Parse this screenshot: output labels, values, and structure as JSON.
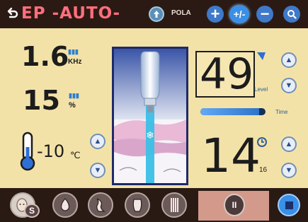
{
  "header": {
    "mode_label": "EP -AUTO-",
    "pola_label": "POLA",
    "plus_symbol": "+",
    "plus_minus_symbol": "+/-",
    "minus_symbol": "−",
    "icons": [
      "back-arrow-icon",
      "up-arrow-icon",
      "plus-icon",
      "plus-minus-icon",
      "minus-icon",
      "search-icon"
    ]
  },
  "frequency": {
    "value": "1.6",
    "unit": "KHz"
  },
  "intensity": {
    "value": "15",
    "unit": "%"
  },
  "temperature": {
    "value": "-10",
    "unit": "℃"
  },
  "level": {
    "value": "49",
    "label": "Level"
  },
  "timer": {
    "label": "Time",
    "progress": 0.9,
    "minutes": "14",
    "seconds": "16"
  },
  "bottom": {
    "s_label": "S",
    "tools": [
      "face-icon",
      "body-area-1-icon",
      "body-area-2-icon",
      "body-area-3-icon",
      "legs-icon"
    ],
    "pause_symbol": "II"
  },
  "colors": {
    "accent": "#3a8fe6",
    "mode_text": "#ff6f7d",
    "background": "#f3e2a8",
    "bar": "#2b1a14"
  }
}
